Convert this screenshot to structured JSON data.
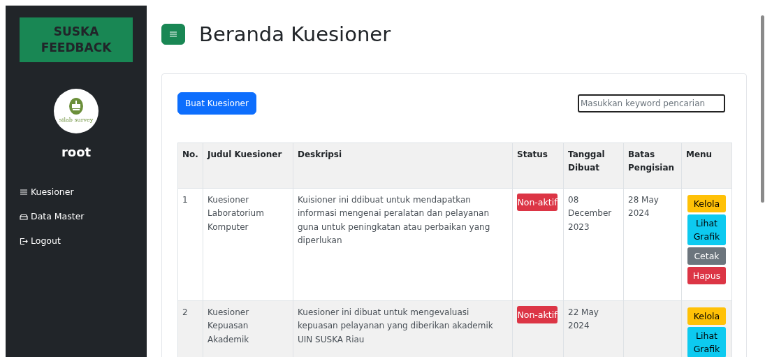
{
  "sidebar": {
    "brand": "SUSKA FEEDBACK",
    "logo_text": "silab survey",
    "user": "root",
    "items": [
      {
        "label": "Kuesioner"
      },
      {
        "label": "Data Master"
      },
      {
        "label": "Logout"
      }
    ]
  },
  "header": {
    "title": "Beranda Kuesioner"
  },
  "toolbar": {
    "create_button": "Buat Kuesioner",
    "search": {
      "placeholder": "Masukkan keyword pencarian"
    }
  },
  "table": {
    "columns": [
      "No.",
      "Judul Kuesioner",
      "Deskripsi",
      "Status",
      "Tanggal Dibuat",
      "Batas Pengisian",
      "Menu"
    ],
    "rows": [
      {
        "no": "1",
        "title": "Kuesioner Laboratorium Komputer",
        "description": "Kuisioner ini ddibuat untuk mendapatkan informasi mengenai peralatan dan pelayanan guna untuk peningkatan atau perbaikan yang diperlukan",
        "status": {
          "label": "Non-aktif",
          "kind": "inactive"
        },
        "created": "08 December 2023",
        "deadline": "28 May 2024",
        "actions": [
          {
            "label": "Kelola",
            "kind": "manage"
          },
          {
            "label": "Lihat Grafik",
            "kind": "chart"
          },
          {
            "label": "Cetak",
            "kind": "print"
          },
          {
            "label": "Hapus",
            "kind": "delete"
          }
        ]
      },
      {
        "no": "2",
        "title": "Kuesioner Kepuasan Akademik",
        "description": "Kuesioner ini dibuat untuk mengevaluasi kepuasan pelayanan yang diberikan akademik UIN SUSKA Riau",
        "status": {
          "label": "Non-aktif",
          "kind": "inactive"
        },
        "created": "22 May 2024",
        "actions": [
          {
            "label": "Kelola",
            "kind": "manage"
          },
          {
            "label": "Lihat Grafik",
            "kind": "chart"
          }
        ]
      }
    ]
  }
}
